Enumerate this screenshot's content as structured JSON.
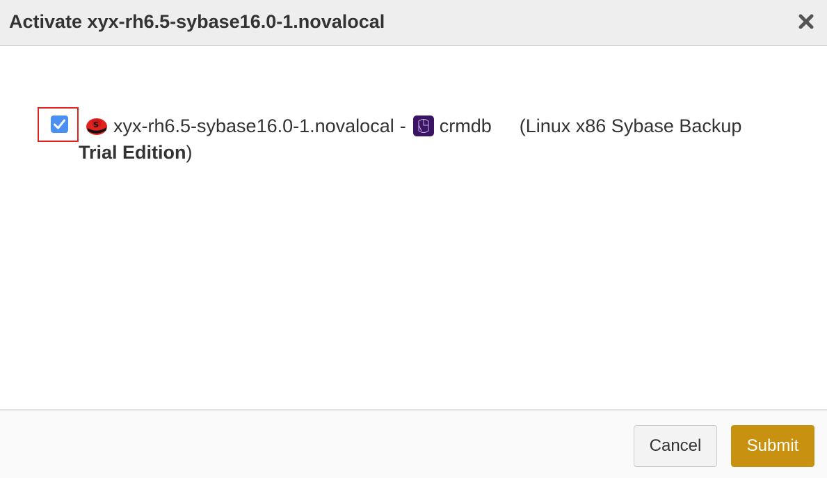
{
  "dialog": {
    "title": "Activate xyx-rh6.5-sybase16.0-1.novalocal",
    "close_icon": "close-icon"
  },
  "item": {
    "checked": true,
    "os_icon": "redhat-icon",
    "host": "xyx-rh6.5-sybase16.0-1.novalocal",
    "separator": "-",
    "db_icon": "sybase-database-icon",
    "db_name": "crmdb",
    "app_type_prefix": "(Linux x86 Sybase Backup",
    "edition": "Trial Edition",
    "app_type_suffix": ")"
  },
  "footer": {
    "cancel_label": "Cancel",
    "submit_label": "Submit"
  },
  "colors": {
    "header_bg": "#eeeeee",
    "checkbox": "#4a8ff2",
    "highlight_border": "#e0231f",
    "submit_bg": "#c8910f",
    "db_icon_bg": "#3b1463"
  }
}
